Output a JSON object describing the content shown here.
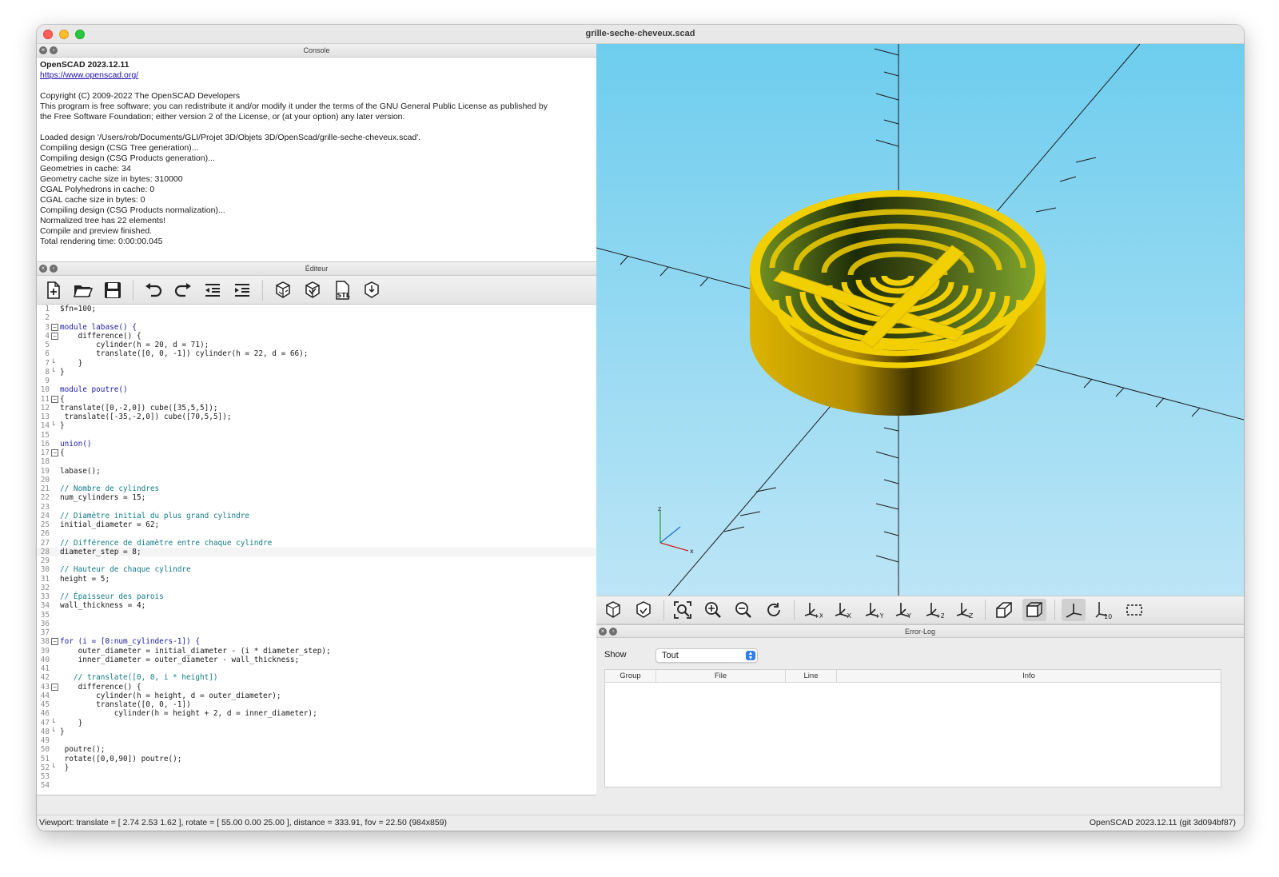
{
  "window": {
    "title": "grille-seche-cheveux.scad"
  },
  "console": {
    "title": "Console",
    "lines": [
      "OpenSCAD 2023.12.11",
      "https://www.openscad.org/",
      "",
      "Copyright (C) 2009-2022 The OpenSCAD Developers",
      "This program is free software; you can redistribute it and/or modify it under the terms of the GNU General Public License as published by",
      "the Free Software Foundation; either version 2 of the License, or (at your option) any later version.",
      "",
      "Loaded design '/Users/rob/Documents/GLI/Projet 3D/Objets 3D/OpenScad/grille-seche-cheveux.scad'.",
      "Compiling design (CSG Tree generation)...",
      "Compiling design (CSG Products generation)...",
      "Geometries in cache: 34",
      "Geometry cache size in bytes: 310000",
      "CGAL Polyhedrons in cache: 0",
      "CGAL cache size in bytes: 0",
      "Compiling design (CSG Products normalization)...",
      "Normalized tree has 22 elements!",
      "Compile and preview finished.",
      "Total rendering time: 0:00:00.045"
    ]
  },
  "editor": {
    "title": "Éditeur",
    "toolbar": [
      "new-file",
      "open-file",
      "save-file",
      "undo",
      "redo",
      "unindent",
      "indent",
      "preview",
      "render",
      "export-stl",
      "send-to-printer"
    ],
    "current_line": 28,
    "lines": [
      "$fn=100;",
      "",
      "module labase() {",
      "    difference() {",
      "        cylinder(h = 20, d = 71);",
      "        translate([0, 0, -1]) cylinder(h = 22, d = 66);",
      "    }",
      "}",
      "",
      "module poutre()",
      "{",
      "translate([0,-2,0]) cube([35,5,5]);",
      " translate([-35,-2,0]) cube([70,5,5]);",
      "}",
      "",
      "union()",
      "{",
      "",
      "labase();",
      "",
      "// Nombre de cylindres",
      "num_cylinders = 15;",
      "",
      "// Diamètre initial du plus grand cylindre",
      "initial_diameter = 62;",
      "",
      "// Différence de diamètre entre chaque cylindre",
      "diameter_step = 8;",
      "",
      "// Hauteur de chaque cylindre",
      "height = 5;",
      "",
      "// Épaisseur des parois",
      "wall_thickness = 4;",
      "",
      "",
      "",
      "for (i = [0:num_cylinders-1]) {",
      "    outer_diameter = initial_diameter - (i * diameter_step);",
      "    inner_diameter = outer_diameter - wall_thickness;",
      "",
      "   // translate([0, 0, i * height])",
      "    difference() {",
      "        cylinder(h = height, d = outer_diameter);",
      "        translate([0, 0, -1])",
      "            cylinder(h = height + 2, d = inner_diameter);",
      "    }",
      "}",
      "",
      " poutre();",
      " rotate([0,0,90]) poutre();",
      " }",
      "",
      ""
    ]
  },
  "view_toolbar": [
    "preview",
    "render",
    "view-all",
    "zoom-in",
    "zoom-out",
    "reset-view",
    "right",
    "top",
    "bottom",
    "left",
    "front",
    "back",
    "perspective",
    "orthogonal",
    "show-axes",
    "show-scale-markers",
    "show-edges"
  ],
  "error_log": {
    "title": "Error-Log",
    "show_label": "Show",
    "show_value": "Tout",
    "columns": [
      "Group",
      "File",
      "Line",
      "Info"
    ]
  },
  "status": {
    "left": "Viewport: translate = [ 2.74 2.53 1.62 ], rotate = [ 55.00 0.00 25.00 ], distance = 333.91, fov = 22.50 (984x859)",
    "right": "OpenSCAD 2023.12.11 (git 3d094bf87)"
  },
  "colors": {
    "model": "#f2cf00",
    "viewport_top": "#6ecdee",
    "viewport_bottom": "#bfe6f6"
  }
}
